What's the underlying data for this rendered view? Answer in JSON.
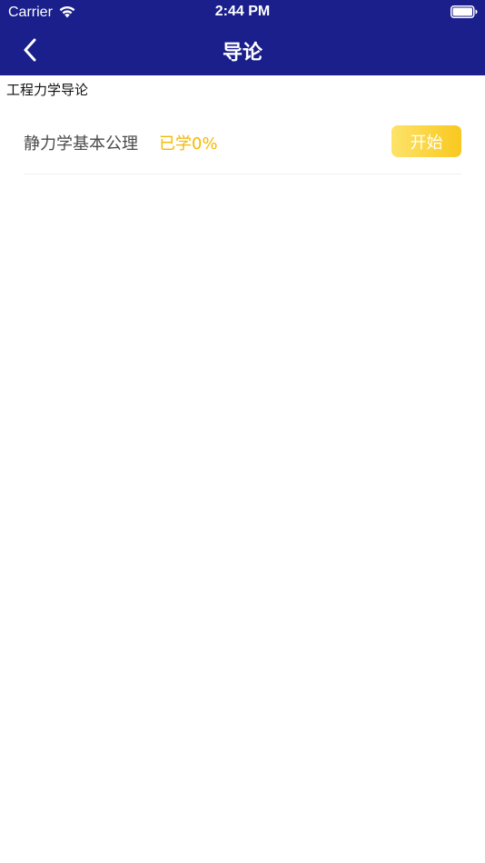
{
  "status_bar": {
    "carrier": "Carrier",
    "time": "2:44 PM"
  },
  "nav": {
    "title": "导论",
    "back_icon": "chevron-left-icon",
    "background": "#1a1f8c"
  },
  "section": {
    "title": "工程力学导论"
  },
  "lessons": [
    {
      "name": "静力学基本公理",
      "progress": "已学0%",
      "action_label": "开始"
    }
  ],
  "colors": {
    "accent": "#f5b800",
    "button_gradient_start": "#fde36a",
    "button_gradient_end": "#f9c81e"
  }
}
